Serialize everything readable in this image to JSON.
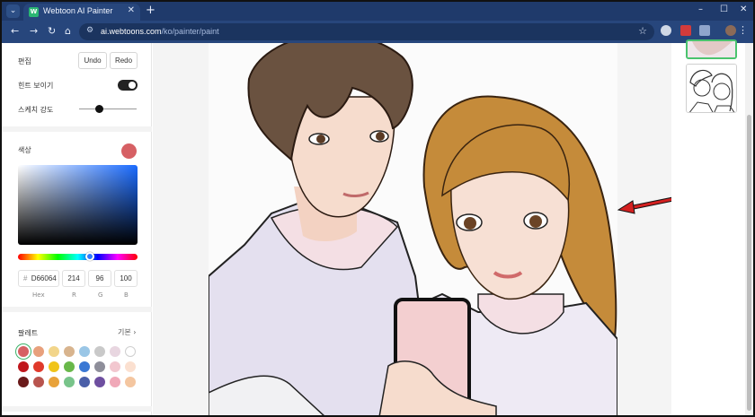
{
  "browser": {
    "tab_title": "Webtoon AI Painter",
    "favicon_text": "W",
    "url_host": "ai.webtoons.com",
    "url_path": "/ko/painter/paint"
  },
  "panel": {
    "edit_label": "편집",
    "undo_label": "Undo",
    "redo_label": "Redo",
    "hint_label": "힌트 보이기",
    "hint_on": true,
    "sketch_label": "스케치 강도",
    "color_label": "색상",
    "hex_prefix": "#",
    "hex_value": "D66064",
    "r_value": "214",
    "g_value": "96",
    "b_value": "100",
    "hex_caption": "Hex",
    "r_caption": "R",
    "g_caption": "G",
    "b_caption": "B",
    "palette_label": "팔레트",
    "palette_mode": "기본 ›"
  },
  "colors": {
    "selected": "#D66064",
    "palette_row1": [
      "#D66064",
      "#E8A07C",
      "#F2D58A",
      "#D8B48E",
      "#9AC6E6",
      "#C9C9C9",
      "#E8D6E0",
      "#FFFFFF"
    ],
    "palette_row2": [
      "#C0161C",
      "#E03A2B",
      "#F0C419",
      "#69B84A",
      "#3A78D4",
      "#8E8E9A",
      "#F2C7CF",
      "#FBE0D0"
    ],
    "palette_row3": [
      "#6A1A1A",
      "#B8544E",
      "#E8A23A",
      "#78C48A",
      "#4A5FA8",
      "#6E4FA0",
      "#F0A8B8",
      "#F4C6A0"
    ]
  }
}
